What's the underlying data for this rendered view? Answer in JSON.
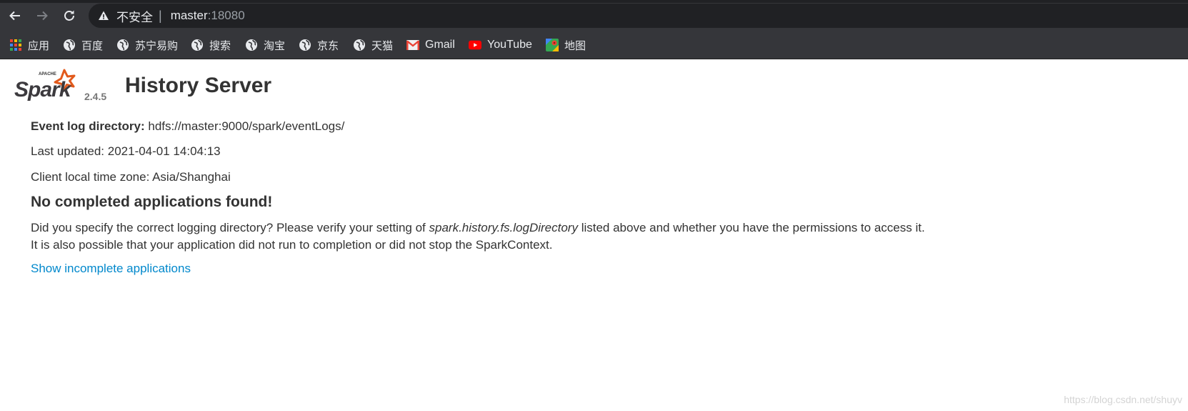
{
  "browser": {
    "address": {
      "security_label": "不安全",
      "separator": "|",
      "host": "master",
      "port": ":18080"
    },
    "bookmarks": [
      {
        "label": "应用",
        "icon": "apps-grid-icon"
      },
      {
        "label": "百度",
        "icon": "globe-icon"
      },
      {
        "label": "苏宁易购",
        "icon": "globe-icon"
      },
      {
        "label": "搜索",
        "icon": "globe-icon"
      },
      {
        "label": "淘宝",
        "icon": "globe-icon"
      },
      {
        "label": "京东",
        "icon": "globe-icon"
      },
      {
        "label": "天猫",
        "icon": "globe-icon"
      },
      {
        "label": "Gmail",
        "icon": "gmail-icon"
      },
      {
        "label": "YouTube",
        "icon": "youtube-icon"
      },
      {
        "label": "地图",
        "icon": "maps-icon"
      }
    ]
  },
  "page": {
    "logo": {
      "apache": "APACHE",
      "spark": "Spark",
      "version": "2.4.5"
    },
    "title": "History Server",
    "event_log": {
      "label": "Event log directory:",
      "value": "hdfs://master:9000/spark/eventLogs/"
    },
    "last_updated": "Last updated: 2021-04-01 14:04:13",
    "time_zone": "Client local time zone: Asia/Shanghai",
    "empty_heading": "No completed applications found!",
    "help_line1_pre": "Did you specify the correct logging directory? Please verify your setting of ",
    "help_line1_em": "spark.history.fs.logDirectory",
    "help_line1_post": " listed above and whether you have the permissions to access it.",
    "help_line2": "It is also possible that your application did not run to completion or did not stop the SparkContext.",
    "incomplete_link": "Show incomplete applications"
  },
  "watermark": "https://blog.csdn.net/shuyv",
  "colors": {
    "chrome_bg": "#35363a",
    "omnibox_bg": "#202124",
    "link": "#0088cc",
    "spark_orange": "#e25a1c"
  }
}
